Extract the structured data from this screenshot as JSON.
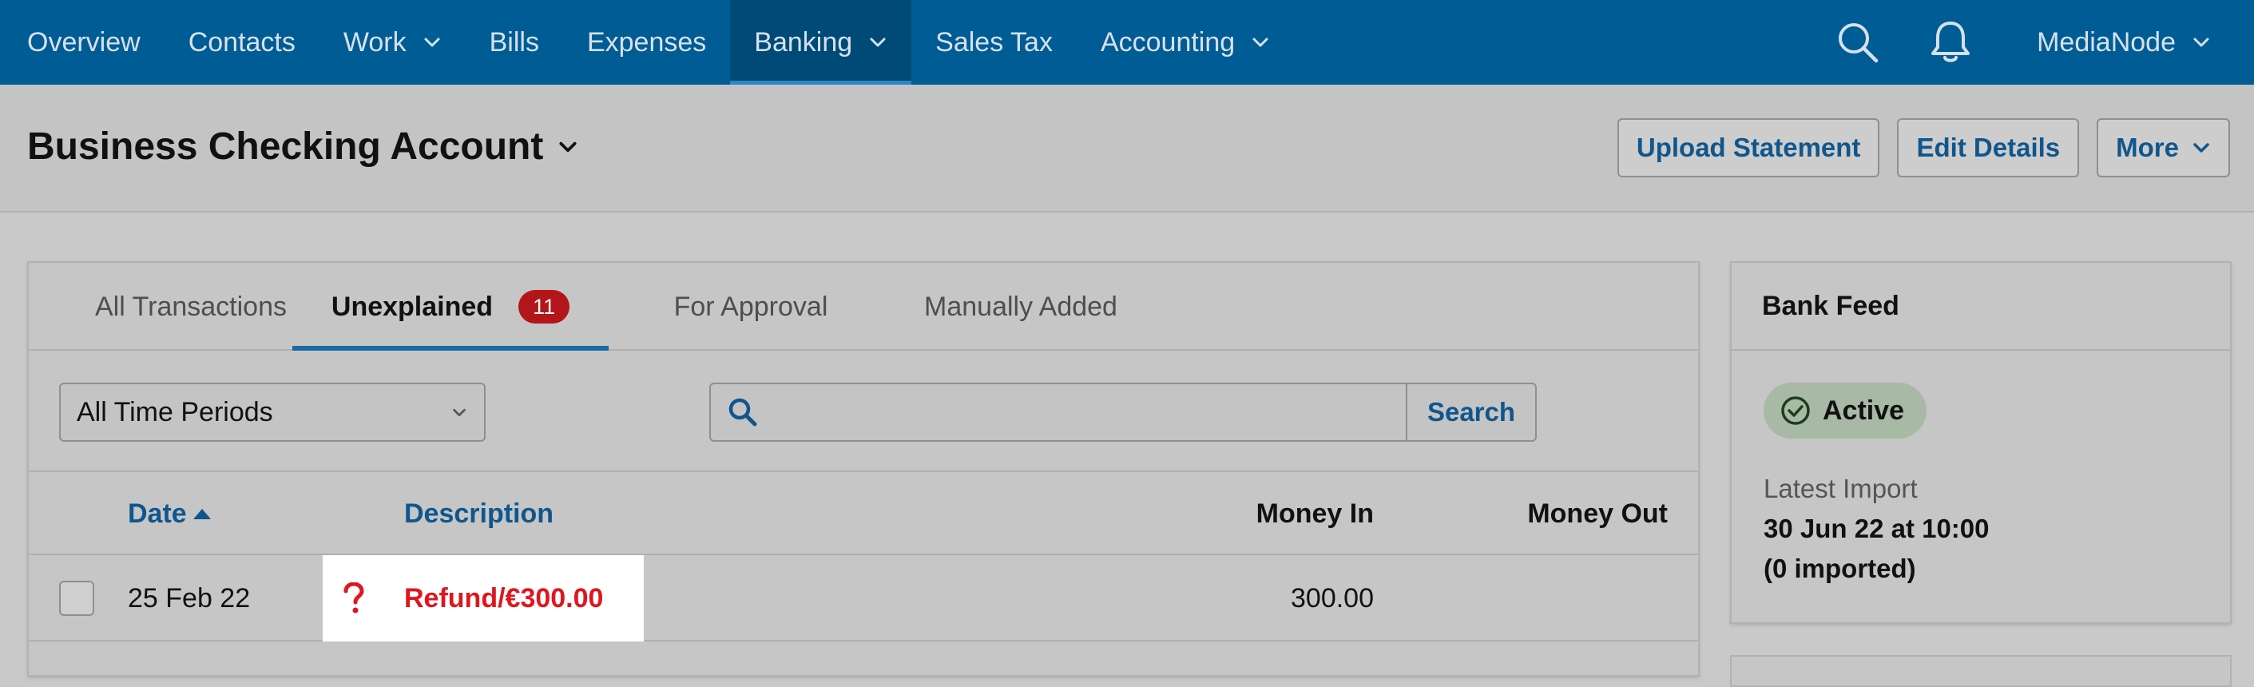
{
  "nav": {
    "items": [
      {
        "label": "Overview",
        "dropdown": false
      },
      {
        "label": "Contacts",
        "dropdown": false
      },
      {
        "label": "Work",
        "dropdown": true
      },
      {
        "label": "Bills",
        "dropdown": false
      },
      {
        "label": "Expenses",
        "dropdown": false
      },
      {
        "label": "Banking",
        "dropdown": true,
        "active": true
      },
      {
        "label": "Sales Tax",
        "dropdown": false
      },
      {
        "label": "Accounting",
        "dropdown": true
      }
    ],
    "icons": [
      "search-icon",
      "bell-icon"
    ],
    "user_label": "MediaNode"
  },
  "header": {
    "title": "Business Checking Account",
    "buttons": {
      "upload": "Upload Statement",
      "edit": "Edit Details",
      "more": "More"
    }
  },
  "tabs": {
    "all": "All Transactions",
    "unexplained": "Unexplained",
    "unexplained_count": "11",
    "approval": "For Approval",
    "manual": "Manually Added"
  },
  "filters": {
    "period": "All Time Periods",
    "search_placeholder": "",
    "search_button": "Search"
  },
  "table": {
    "columns": {
      "date": "Date",
      "description": "Description",
      "money_in": "Money In",
      "money_out": "Money Out"
    },
    "rows": [
      {
        "date": "25 Feb 22",
        "description": "Refund/€300.00",
        "money_in": "300.00",
        "money_out": "",
        "status_icon": "question-icon"
      }
    ]
  },
  "bank_feed": {
    "title": "Bank Feed",
    "status": "Active",
    "latest_import_label": "Latest Import",
    "latest_import_time": "30 Jun 22 at 10:00",
    "imported_count": "(0 imported)"
  },
  "colors": {
    "nav_bg": "#005c94",
    "accent": "#10568d",
    "badge": "#b2161b",
    "alert_text": "#e0161e",
    "status_bg": "#a8b9a6"
  }
}
